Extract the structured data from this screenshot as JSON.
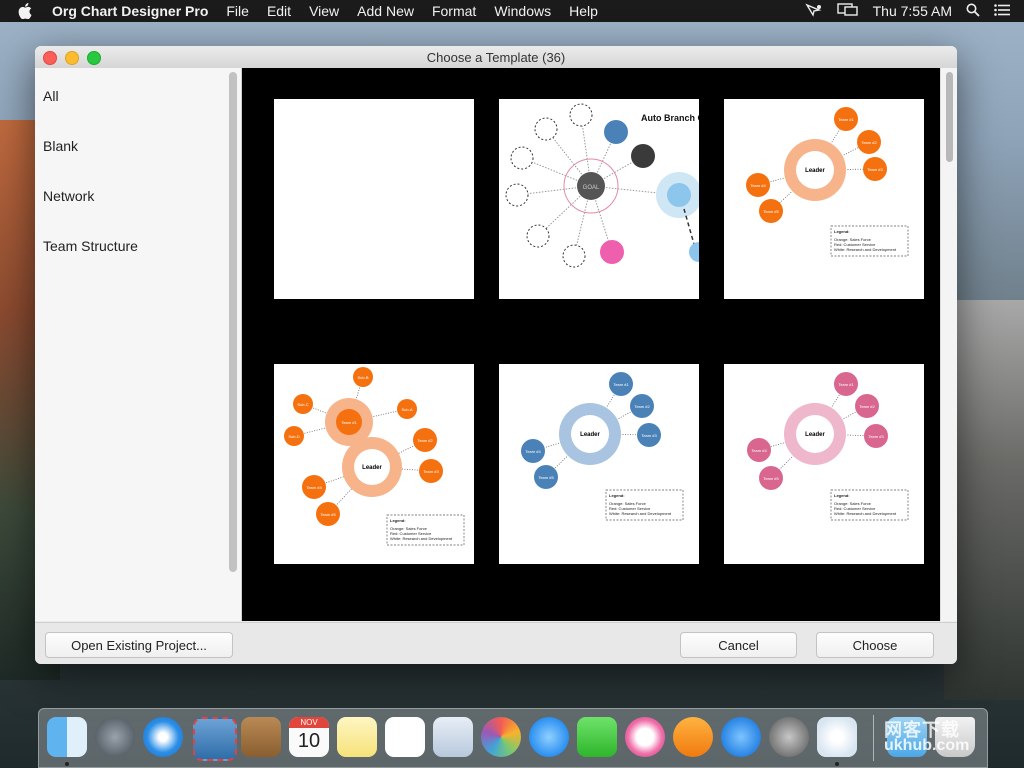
{
  "menubar": {
    "app_name": "Org Chart Designer Pro",
    "items": [
      "File",
      "Edit",
      "View",
      "Add New",
      "Format",
      "Windows",
      "Help"
    ],
    "clock": "Thu 7:55 AM"
  },
  "window": {
    "title": "Choose a Template (36)"
  },
  "sidebar": {
    "items": [
      "All",
      "Blank",
      "Network",
      "Team Structure"
    ]
  },
  "templates": {
    "auto_branch_title": "Auto Branch G",
    "goal_label": "GOAL",
    "leader_label": "Leader",
    "team1": "Team #1",
    "team2": "Team #2",
    "team3": "Team #3",
    "team4": "Team #4",
    "team5": "Team #5",
    "sub_a": "Sub-A",
    "sub_b": "Sub-B",
    "sub_c": "Sub-C",
    "sub_d": "Sub-D",
    "legend_title": "Legend:",
    "legend_orange": "Orange: Sales Force",
    "legend_red": "Red: Customer Service",
    "legend_white": "White: Research and Development"
  },
  "footer": {
    "open_existing": "Open Existing Project...",
    "cancel": "Cancel",
    "choose": "Choose"
  },
  "dock": {
    "calendar_month": "NOV",
    "calendar_day": "10"
  },
  "watermark": {
    "line1": "网客下载",
    "line2": "ukhub.com"
  },
  "colors": {
    "orange": "#f5700f",
    "orange_light": "#f7b48a",
    "blue": "#4a82b8",
    "blue_light": "#a9c4e0",
    "pink": "#d9668f",
    "pink_light": "#efb7cb"
  }
}
